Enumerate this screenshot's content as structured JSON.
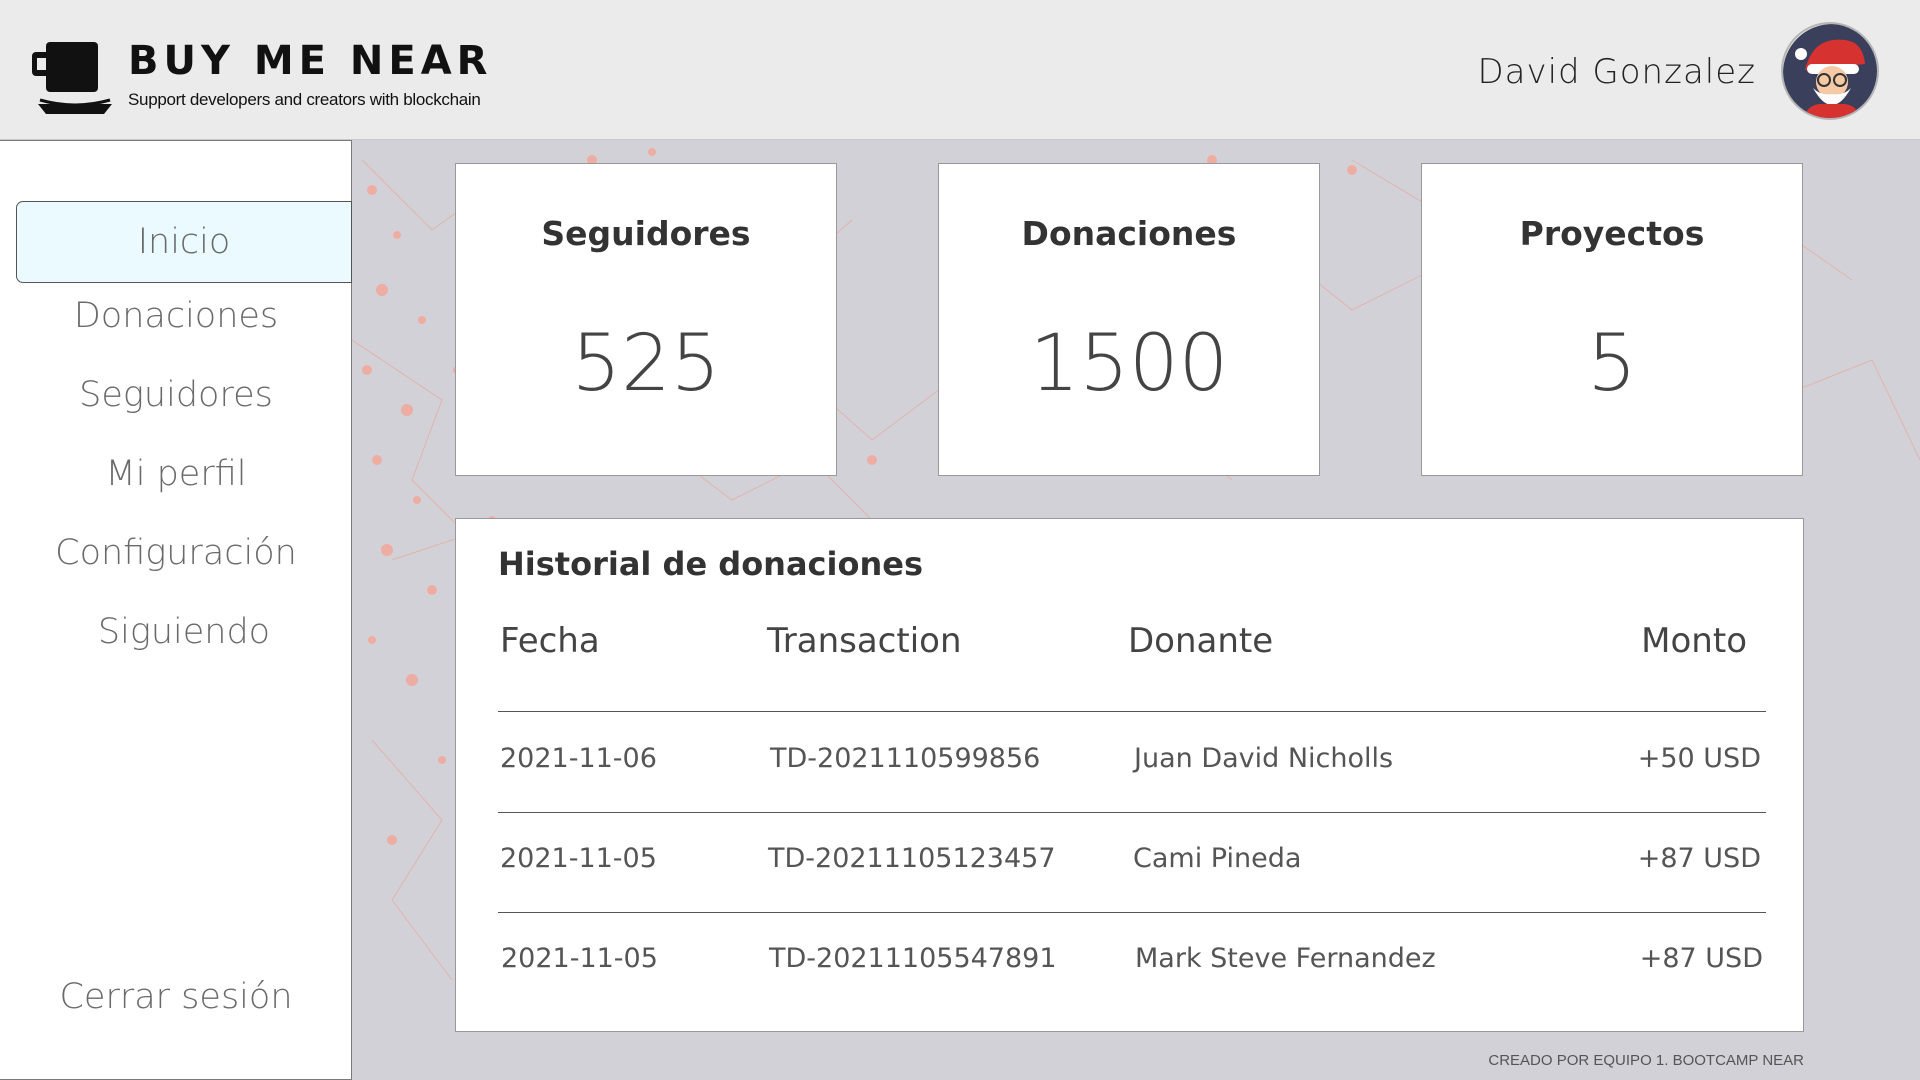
{
  "header": {
    "brand_title": "BUY ME NEAR",
    "brand_subtitle": "Support developers and creators with blockchain",
    "user_name": "David Gonzalez",
    "logo_icon": "coffee-cup-icon",
    "avatar_icon": "santa-avatar"
  },
  "sidebar": {
    "items": [
      {
        "label": "Inicio",
        "active": true
      },
      {
        "label": "Donaciones"
      },
      {
        "label": "Seguidores"
      },
      {
        "label": "Mi perfil"
      },
      {
        "label": "Configuración"
      },
      {
        "label": "Siguiendo"
      }
    ],
    "logout_label": "Cerrar sesión"
  },
  "stats": [
    {
      "title": "Seguidores",
      "value": "525"
    },
    {
      "title": "Donaciones",
      "value": "1500"
    },
    {
      "title": "Proyectos",
      "value": "5"
    }
  ],
  "history": {
    "title": "Historial de donaciones",
    "columns": [
      "Fecha",
      "Transaction",
      "Donante",
      "Monto"
    ],
    "rows": [
      [
        "2021-11-06",
        "TD-202111059985​6",
        "Juan David Nicholls",
        "+50 USD"
      ],
      [
        "2021-11-05",
        "TD-20211105123457",
        "Cami Pineda",
        "+87 USD"
      ],
      [
        "2021-11-05",
        "TD-20211105547891",
        "Mark Steve Fernandez",
        "+87 USD"
      ]
    ]
  },
  "footer": "CREADO POR EQUIPO 1. BOOTCAMP NEAR",
  "colors": {
    "background": "#d3d1d8",
    "header": "#ebebeb",
    "active_nav": "#eafaff",
    "network_accent": "#f0a08a"
  }
}
